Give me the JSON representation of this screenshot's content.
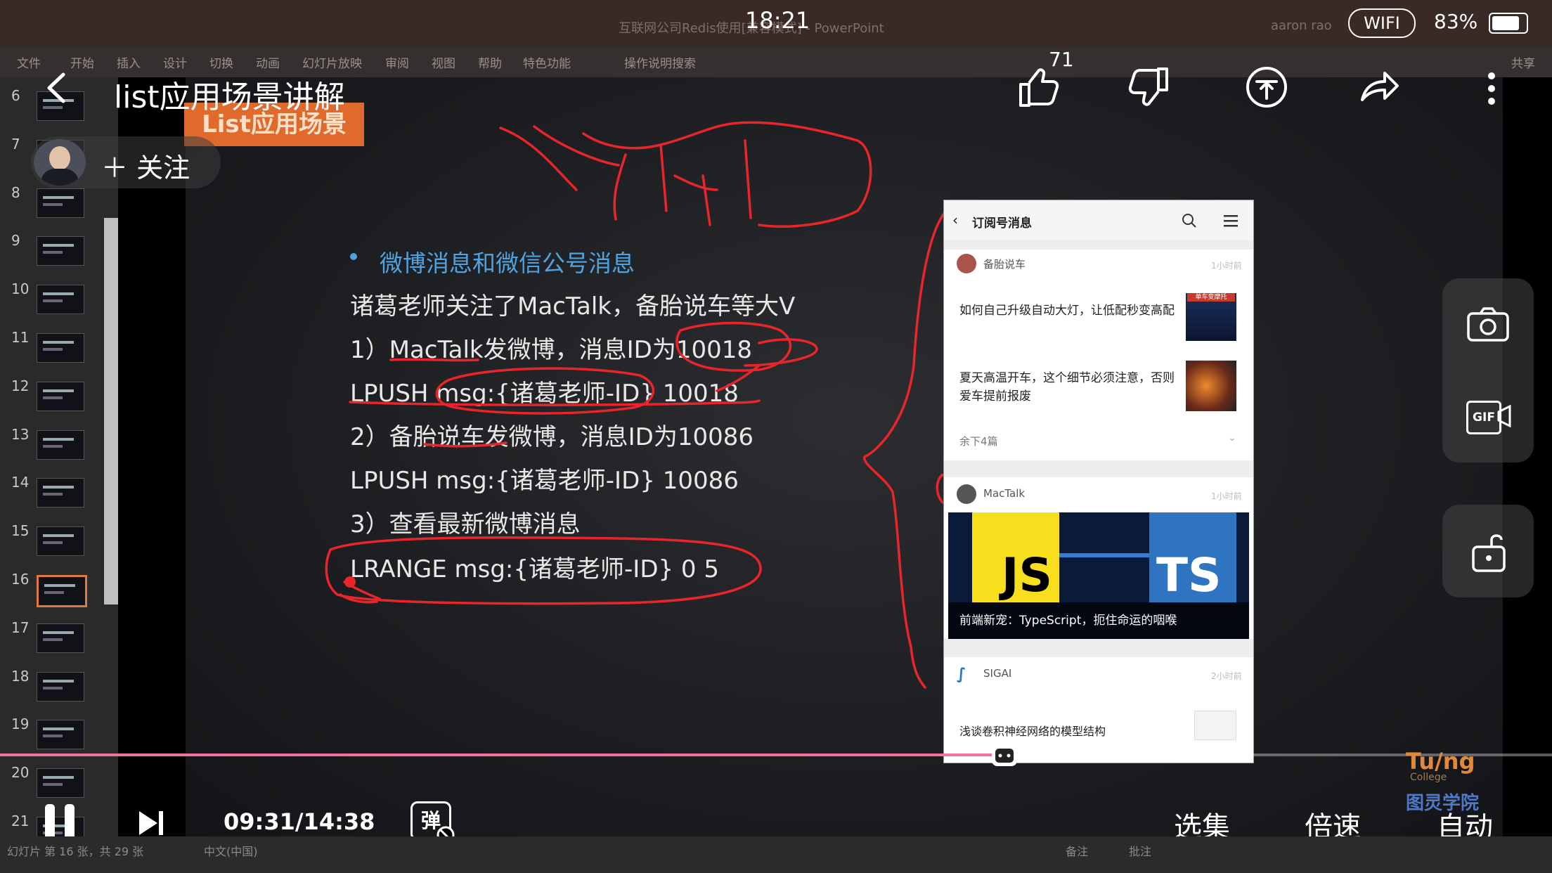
{
  "status_bar": {
    "time": "18:21",
    "wifi": "WIFI",
    "battery": "83%"
  },
  "ppt": {
    "doc_title": "互联网公司Redis使用[兼容模式] - PowerPoint",
    "user": "aaron rao",
    "ribbon_tabs": [
      "文件",
      "开始",
      "插入",
      "设计",
      "切换",
      "动画",
      "幻灯片放映",
      "审阅",
      "视图",
      "帮助",
      "特色功能"
    ],
    "search_hint": "操作说明搜索",
    "share": "共享",
    "status_slide": "幻灯片 第 16 张，共 29 张",
    "status_lang": "中文(中国)",
    "status_notes": "备注",
    "status_comments": "批注"
  },
  "thumbnails": [
    {
      "num": "6",
      "active": false
    },
    {
      "num": "7",
      "active": false
    },
    {
      "num": "8",
      "active": false
    },
    {
      "num": "9",
      "active": false
    },
    {
      "num": "10",
      "active": false
    },
    {
      "num": "11",
      "active": false
    },
    {
      "num": "12",
      "active": false
    },
    {
      "num": "13",
      "active": false
    },
    {
      "num": "14",
      "active": false
    },
    {
      "num": "15",
      "active": false
    },
    {
      "num": "16",
      "active": true
    },
    {
      "num": "17",
      "active": false
    },
    {
      "num": "18",
      "active": false
    },
    {
      "num": "19",
      "active": false
    },
    {
      "num": "20",
      "active": false
    },
    {
      "num": "21",
      "active": false
    }
  ],
  "slide": {
    "tag": "List应用场景",
    "heading": "微博消息和微信公号消息",
    "lines": [
      "诸葛老师关注了MacTalk，备胎说车等大V",
      "1）MacTalk发微博，消息ID为10018",
      "LPUSH  msg:{诸葛老师-ID}  10018",
      "2）备胎说车发微博，消息ID为10086",
      "LPUSH  msg:{诸葛老师-ID} 10086",
      "3）查看最新微博消息",
      "LRANGE  msg:{诸葛老师-ID}  0  5"
    ]
  },
  "phone": {
    "header_title": "订阅号消息",
    "account1": "备胎说车",
    "account1_time": "1小时前",
    "article1": "如何自己升级自动大灯，让低配秒变高配",
    "article1_badge": "单车变摩托",
    "article2": "夏天高温开车，这个细节必须注意，否则爱车提前报废",
    "more": "余下4篇",
    "account2": "MacTalk",
    "account2_time": "1小时前",
    "js": "JS",
    "ts": "TS",
    "banner_caption": "前端新宠：TypeScript，扼住命运的咽喉",
    "account3": "SIGAI",
    "account3_time": "2小时前",
    "article3": "浅谈卷积神经网络的模型结构"
  },
  "player": {
    "title": "list应用场景讲解",
    "follow": "＋ 关注",
    "like_count": "71",
    "time": "09:31/14:38",
    "progress": 0.647,
    "danmaku": "弹",
    "episodes": "选集",
    "speed": "倍速",
    "quality": "自动",
    "gif_label": "GIF"
  },
  "watermark": {
    "en": "Tu/ng",
    "en_sub": "College",
    "cn": "图灵学院"
  },
  "colors": {
    "accent_orange": "#e06a2c",
    "heading_blue": "#4fa3e0",
    "progress_pink": "#f2729b",
    "annotation_red": "#e8252a"
  }
}
